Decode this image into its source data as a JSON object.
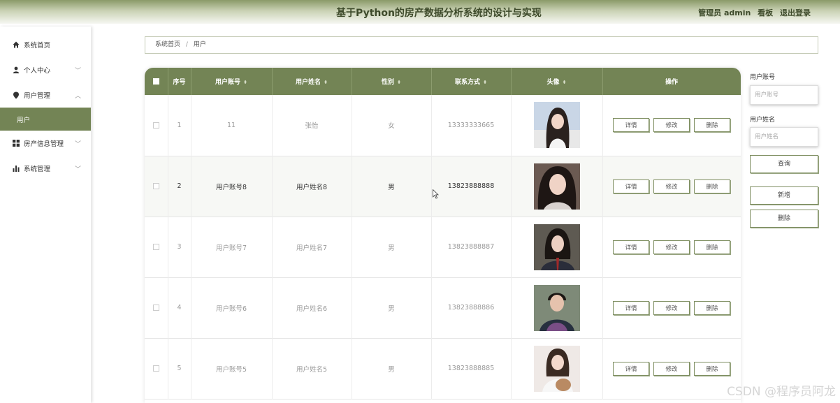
{
  "header": {
    "title": "基于Python的房产数据分析系统的设计与实现",
    "admin_label": "管理员 admin",
    "dashboard_link": "看板",
    "logout_link": "退出登录"
  },
  "sidebar": {
    "items": [
      {
        "label": "系统首页",
        "icon": "home-icon"
      },
      {
        "label": "个人中心",
        "icon": "person-icon"
      },
      {
        "label": "用户管理",
        "icon": "location-pin-icon"
      },
      {
        "label": "用户",
        "icon": ""
      },
      {
        "label": "房产信息管理",
        "icon": "grid-icon"
      },
      {
        "label": "系统管理",
        "icon": "bar-chart-icon"
      }
    ]
  },
  "breadcrumb": {
    "home": "系统首页",
    "separator": "/",
    "current": "用户"
  },
  "table": {
    "columns": [
      "序号",
      "用户账号",
      "用户姓名",
      "性别",
      "联系方式",
      "头像",
      "操作"
    ],
    "actions": [
      "详情",
      "修改",
      "删除"
    ],
    "rows": [
      {
        "index": "1",
        "account": "11",
        "name": "张怡",
        "gender": "女",
        "phone": "13333333665"
      },
      {
        "index": "2",
        "account": "用户账号8",
        "name": "用户姓名8",
        "gender": "男",
        "phone": "13823888888"
      },
      {
        "index": "3",
        "account": "用户账号7",
        "name": "用户姓名7",
        "gender": "男",
        "phone": "13823888887"
      },
      {
        "index": "4",
        "account": "用户账号6",
        "name": "用户姓名6",
        "gender": "男",
        "phone": "13823888886"
      },
      {
        "index": "5",
        "account": "用户账号5",
        "name": "用户姓名5",
        "gender": "男",
        "phone": "13823888885"
      }
    ]
  },
  "search": {
    "account_label": "用户账号",
    "account_placeholder": "用户账号",
    "name_label": "用户姓名",
    "name_placeholder": "用户姓名",
    "query_button": "查询",
    "add_button": "新增",
    "delete_button": "删除"
  },
  "watermark": "CSDN @程序员阿龙",
  "colors": {
    "accent": "#738455",
    "header_text": "#3d4a2a"
  }
}
